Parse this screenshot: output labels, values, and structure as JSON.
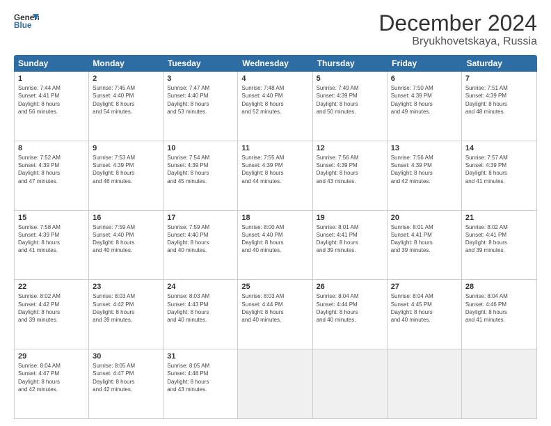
{
  "logo": {
    "line1": "General",
    "line2": "Blue"
  },
  "title": "December 2024",
  "subtitle": "Bryukhovetskaya, Russia",
  "days": [
    "Sunday",
    "Monday",
    "Tuesday",
    "Wednesday",
    "Thursday",
    "Friday",
    "Saturday"
  ],
  "weeks": [
    [
      {
        "day": "1",
        "info": "Sunrise: 7:44 AM\nSunset: 4:41 PM\nDaylight: 8 hours\nand 56 minutes."
      },
      {
        "day": "2",
        "info": "Sunrise: 7:45 AM\nSunset: 4:40 PM\nDaylight: 8 hours\nand 54 minutes."
      },
      {
        "day": "3",
        "info": "Sunrise: 7:47 AM\nSunset: 4:40 PM\nDaylight: 8 hours\nand 53 minutes."
      },
      {
        "day": "4",
        "info": "Sunrise: 7:48 AM\nSunset: 4:40 PM\nDaylight: 8 hours\nand 52 minutes."
      },
      {
        "day": "5",
        "info": "Sunrise: 7:49 AM\nSunset: 4:39 PM\nDaylight: 8 hours\nand 50 minutes."
      },
      {
        "day": "6",
        "info": "Sunrise: 7:50 AM\nSunset: 4:39 PM\nDaylight: 8 hours\nand 49 minutes."
      },
      {
        "day": "7",
        "info": "Sunrise: 7:51 AM\nSunset: 4:39 PM\nDaylight: 8 hours\nand 48 minutes."
      }
    ],
    [
      {
        "day": "8",
        "info": "Sunrise: 7:52 AM\nSunset: 4:39 PM\nDaylight: 8 hours\nand 47 minutes."
      },
      {
        "day": "9",
        "info": "Sunrise: 7:53 AM\nSunset: 4:39 PM\nDaylight: 8 hours\nand 46 minutes."
      },
      {
        "day": "10",
        "info": "Sunrise: 7:54 AM\nSunset: 4:39 PM\nDaylight: 8 hours\nand 45 minutes."
      },
      {
        "day": "11",
        "info": "Sunrise: 7:55 AM\nSunset: 4:39 PM\nDaylight: 8 hours\nand 44 minutes."
      },
      {
        "day": "12",
        "info": "Sunrise: 7:56 AM\nSunset: 4:39 PM\nDaylight: 8 hours\nand 43 minutes."
      },
      {
        "day": "13",
        "info": "Sunrise: 7:56 AM\nSunset: 4:39 PM\nDaylight: 8 hours\nand 42 minutes."
      },
      {
        "day": "14",
        "info": "Sunrise: 7:57 AM\nSunset: 4:39 PM\nDaylight: 8 hours\nand 41 minutes."
      }
    ],
    [
      {
        "day": "15",
        "info": "Sunrise: 7:58 AM\nSunset: 4:39 PM\nDaylight: 8 hours\nand 41 minutes."
      },
      {
        "day": "16",
        "info": "Sunrise: 7:59 AM\nSunset: 4:40 PM\nDaylight: 8 hours\nand 40 minutes."
      },
      {
        "day": "17",
        "info": "Sunrise: 7:59 AM\nSunset: 4:40 PM\nDaylight: 8 hours\nand 40 minutes."
      },
      {
        "day": "18",
        "info": "Sunrise: 8:00 AM\nSunset: 4:40 PM\nDaylight: 8 hours\nand 40 minutes."
      },
      {
        "day": "19",
        "info": "Sunrise: 8:01 AM\nSunset: 4:41 PM\nDaylight: 8 hours\nand 39 minutes."
      },
      {
        "day": "20",
        "info": "Sunrise: 8:01 AM\nSunset: 4:41 PM\nDaylight: 8 hours\nand 39 minutes."
      },
      {
        "day": "21",
        "info": "Sunrise: 8:02 AM\nSunset: 4:41 PM\nDaylight: 8 hours\nand 39 minutes."
      }
    ],
    [
      {
        "day": "22",
        "info": "Sunrise: 8:02 AM\nSunset: 4:42 PM\nDaylight: 8 hours\nand 39 minutes."
      },
      {
        "day": "23",
        "info": "Sunrise: 8:03 AM\nSunset: 4:42 PM\nDaylight: 8 hours\nand 39 minutes."
      },
      {
        "day": "24",
        "info": "Sunrise: 8:03 AM\nSunset: 4:43 PM\nDaylight: 8 hours\nand 40 minutes."
      },
      {
        "day": "25",
        "info": "Sunrise: 8:03 AM\nSunset: 4:44 PM\nDaylight: 8 hours\nand 40 minutes."
      },
      {
        "day": "26",
        "info": "Sunrise: 8:04 AM\nSunset: 4:44 PM\nDaylight: 8 hours\nand 40 minutes."
      },
      {
        "day": "27",
        "info": "Sunrise: 8:04 AM\nSunset: 4:45 PM\nDaylight: 8 hours\nand 40 minutes."
      },
      {
        "day": "28",
        "info": "Sunrise: 8:04 AM\nSunset: 4:46 PM\nDaylight: 8 hours\nand 41 minutes."
      }
    ],
    [
      {
        "day": "29",
        "info": "Sunrise: 8:04 AM\nSunset: 4:47 PM\nDaylight: 8 hours\nand 42 minutes."
      },
      {
        "day": "30",
        "info": "Sunrise: 8:05 AM\nSunset: 4:47 PM\nDaylight: 8 hours\nand 42 minutes."
      },
      {
        "day": "31",
        "info": "Sunrise: 8:05 AM\nSunset: 4:48 PM\nDaylight: 8 hours\nand 43 minutes."
      },
      {
        "day": "",
        "info": ""
      },
      {
        "day": "",
        "info": ""
      },
      {
        "day": "",
        "info": ""
      },
      {
        "day": "",
        "info": ""
      }
    ]
  ]
}
